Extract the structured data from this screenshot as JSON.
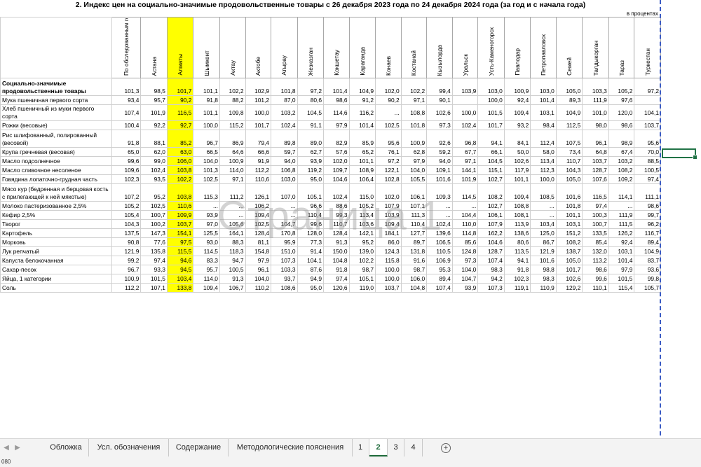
{
  "sheet": {
    "title": "2. Индекс цен на социально-значимые продовольственные товары с 26 декабря 2023 года по 24 декабря 2024 года (за год и с начала года)",
    "units": "в процентах",
    "columns": [
      "По обследованным городам",
      "Астана",
      "Алматы",
      "Шымкент",
      "Актау",
      "Актобе",
      "Атырау",
      "Жезказган",
      "Кокшетау",
      "Караганда",
      "Конаев",
      "Костанай",
      "Кызылорда",
      "Уральск",
      "Усть-Каменогорск",
      "Павлодар",
      "Петропавловск",
      "Семей",
      "Талдыкорган",
      "Тараз",
      "Туркестан"
    ],
    "rows": [
      {
        "name": "Социально-значимые продовольственные товары",
        "type": "section",
        "values": [
          "101,3",
          "98,5",
          "101,7",
          "101,1",
          "102,2",
          "102,9",
          "101,8",
          "97,2",
          "101,4",
          "104,9",
          "102,0",
          "102,2",
          "99,4",
          "103,9",
          "103,0",
          "100,9",
          "103,0",
          "105,0",
          "103,3",
          "105,2",
          "97,2"
        ]
      },
      {
        "name": "Мука пшеничная первого сорта",
        "type": "normal",
        "values": [
          "93,4",
          "95,7",
          "90,2",
          "91,8",
          "88,2",
          "101,2",
          "87,0",
          "80,6",
          "98,6",
          "91,2",
          "90,2",
          "97,1",
          "90,1",
          "",
          "100,0",
          "92,4",
          "101,4",
          "89,3",
          "111,9",
          "97,6",
          ""
        ]
      },
      {
        "name": "Хлеб пшеничный из муки первого сорта",
        "type": "normal",
        "values": [
          "107,4",
          "101,9",
          "116,5",
          "101,1",
          "109,8",
          "100,0",
          "103,2",
          "104,5",
          "114,6",
          "116,2",
          "...",
          "108,8",
          "102,6",
          "100,0",
          "101,5",
          "109,4",
          "103,1",
          "104,9",
          "101,0",
          "120,0",
          "104,1"
        ]
      },
      {
        "name": "Рожки (весовые)",
        "type": "normal",
        "values": [
          "100,4",
          "92,2",
          "92,7",
          "100,0",
          "115,2",
          "101,7",
          "102,4",
          "91,1",
          "97,9",
          "101,4",
          "102,5",
          "101,8",
          "97,3",
          "102,4",
          "101,7",
          "93,2",
          "98,4",
          "112,5",
          "98,0",
          "98,6",
          "103,7"
        ]
      },
      {
        "name": "Рис шлифованный, полированный (весовой)",
        "type": "tall",
        "values": [
          "91,8",
          "88,1",
          "85,2",
          "96,7",
          "86,9",
          "79,4",
          "89,8",
          "89,0",
          "82,9",
          "85,9",
          "95,6",
          "100,9",
          "92,6",
          "96,8",
          "94,1",
          "84,1",
          "112,4",
          "107,5",
          "96,1",
          "98,9",
          "95,6"
        ]
      },
      {
        "name": "Крупа гречневая (весовая)",
        "type": "normal",
        "values": [
          "65,0",
          "62,0",
          "63,0",
          "66,5",
          "64,6",
          "66,6",
          "59,7",
          "62,7",
          "57,6",
          "65,2",
          "76,1",
          "62,8",
          "59,2",
          "67,7",
          "66,1",
          "50,0",
          "58,0",
          "73,4",
          "64,8",
          "67,4",
          "70,0"
        ]
      },
      {
        "name": "Масло подсолнечное",
        "type": "normal",
        "values": [
          "99,6",
          "99,0",
          "106,0",
          "104,0",
          "100,9",
          "91,9",
          "94,0",
          "93,9",
          "102,0",
          "101,1",
          "97,2",
          "97,9",
          "94,0",
          "97,1",
          "104,5",
          "102,6",
          "113,4",
          "110,7",
          "103,7",
          "103,2",
          "88,5"
        ]
      },
      {
        "name": "Масло сливочное несоленое",
        "type": "normal",
        "values": [
          "109,6",
          "102,4",
          "103,8",
          "101,3",
          "114,0",
          "112,2",
          "106,8",
          "119,2",
          "109,7",
          "108,9",
          "122,1",
          "104,0",
          "109,1",
          "144,1",
          "115,1",
          "117,9",
          "112,3",
          "104,3",
          "128,7",
          "108,2",
          "100,5"
        ]
      },
      {
        "name": "Говядина лопаточно-грудная часть",
        "type": "normal",
        "values": [
          "102,3",
          "93,5",
          "102,2",
          "102,5",
          "97,1",
          "110,6",
          "103,0",
          "95,0",
          "104,6",
          "106,4",
          "102,8",
          "105,5",
          "101,6",
          "101,9",
          "102,7",
          "101,1",
          "100,0",
          "105,0",
          "107,6",
          "109,2",
          "97,4"
        ]
      },
      {
        "name": "Мясо кур (бедренная и берцовая кость с прилегающей к ней мякотью)",
        "type": "tall",
        "values": [
          "107,2",
          "95,2",
          "103,8",
          "115,3",
          "111,2",
          "126,1",
          "107,0",
          "105,1",
          "102,4",
          "115,0",
          "102,0",
          "106,1",
          "109,3",
          "114,5",
          "108,2",
          "109,4",
          "108,5",
          "101,6",
          "116,5",
          "114,1",
          "111,1"
        ]
      },
      {
        "name": "Молоко пастеризованное 2,5%",
        "type": "normal",
        "values": [
          "105,2",
          "102,5",
          "110,6",
          "...",
          "...",
          "106,2",
          "...",
          "96,6",
          "88,6",
          "105,2",
          "107,9",
          "107,1",
          "...",
          "...",
          "102,7",
          "108,8",
          "...",
          "101,8",
          "97,4",
          "...",
          "98,6"
        ]
      },
      {
        "name": "Кефир 2,5%",
        "type": "normal",
        "values": [
          "105,4",
          "100,7",
          "109,9",
          "93,9",
          "...",
          "109,4",
          "...",
          "110,4",
          "99,3",
          "113,4",
          "103,9",
          "111,3",
          "...",
          "104,4",
          "106,1",
          "108,1",
          "...",
          "101,1",
          "100,3",
          "111,9",
          "99,7"
        ]
      },
      {
        "name": "Творог",
        "type": "normal",
        "values": [
          "104,3",
          "100,2",
          "103,7",
          "97,0",
          "105,6",
          "102,5",
          "104,7",
          "99,6",
          "110,7",
          "103,6",
          "109,4",
          "110,4",
          "102,4",
          "110,0",
          "107,9",
          "113,9",
          "103,4",
          "103,1",
          "100,7",
          "111,5",
          "96,2"
        ]
      },
      {
        "name": "Картофель",
        "type": "normal",
        "values": [
          "137,5",
          "147,3",
          "154,1",
          "125,5",
          "164,1",
          "128,4",
          "170,8",
          "128,0",
          "128,4",
          "142,1",
          "184,1",
          "127,7",
          "139,6",
          "114,8",
          "162,2",
          "138,6",
          "125,0",
          "151,2",
          "133,5",
          "126,2",
          "116,7"
        ]
      },
      {
        "name": "Морковь",
        "type": "normal",
        "values": [
          "90,8",
          "77,6",
          "97,5",
          "93,0",
          "88,3",
          "81,1",
          "95,9",
          "77,3",
          "91,3",
          "95,2",
          "86,0",
          "89,7",
          "106,5",
          "85,6",
          "104,6",
          "80,6",
          "86,7",
          "108,2",
          "85,4",
          "92,4",
          "89,4"
        ]
      },
      {
        "name": "Лук репчатый",
        "type": "normal",
        "values": [
          "121,9",
          "135,8",
          "115,5",
          "114,5",
          "118,3",
          "154,8",
          "151,0",
          "91,4",
          "150,0",
          "139,0",
          "124,3",
          "131,8",
          "110,5",
          "124,8",
          "128,7",
          "113,5",
          "121,9",
          "138,7",
          "132,0",
          "103,1",
          "104,9"
        ]
      },
      {
        "name": "Капуста белокочанная",
        "type": "normal",
        "values": [
          "99,2",
          "97,4",
          "94,6",
          "83,3",
          "94,7",
          "97,9",
          "107,3",
          "104,1",
          "104,8",
          "102,2",
          "115,8",
          "91,6",
          "106,9",
          "97,3",
          "107,4",
          "94,1",
          "101,6",
          "105,0",
          "113,2",
          "101,4",
          "83,7"
        ]
      },
      {
        "name": "Сахар-песок",
        "type": "normal",
        "values": [
          "96,7",
          "93,3",
          "94,5",
          "95,7",
          "100,5",
          "96,1",
          "103,3",
          "87,6",
          "91,8",
          "98,7",
          "100,0",
          "98,7",
          "95,3",
          "104,0",
          "98,3",
          "91,8",
          "98,8",
          "101,7",
          "98,6",
          "97,9",
          "93,6"
        ]
      },
      {
        "name": "Яйца, 1 категории",
        "type": "normal",
        "values": [
          "100,9",
          "101,5",
          "103,4",
          "114,0",
          "91,3",
          "104,0",
          "93,7",
          "94,9",
          "97,4",
          "105,1",
          "100,0",
          "106,0",
          "89,4",
          "104,7",
          "94,2",
          "102,3",
          "98,3",
          "102,6",
          "99,6",
          "101,5",
          "99,8"
        ]
      },
      {
        "name": "Соль",
        "type": "normal",
        "values": [
          "112,2",
          "107,1",
          "133,8",
          "109,4",
          "106,7",
          "110,2",
          "108,6",
          "95,0",
          "120,6",
          "119,0",
          "103,7",
          "104,8",
          "107,4",
          "93,9",
          "107,3",
          "119,1",
          "110,9",
          "129,2",
          "110,1",
          "115,4",
          "105,7"
        ]
      }
    ],
    "watermark": "Страница 1",
    "highlight_color": "#ffff00"
  },
  "tabs": {
    "items": [
      "Обложка",
      "Усл. обозначения",
      "Содержание",
      "Методологические пояснения",
      "1",
      "2",
      "3",
      "4"
    ],
    "active_index": 5,
    "add_icon": "plus-circle-icon"
  },
  "status": {
    "text": "080"
  }
}
